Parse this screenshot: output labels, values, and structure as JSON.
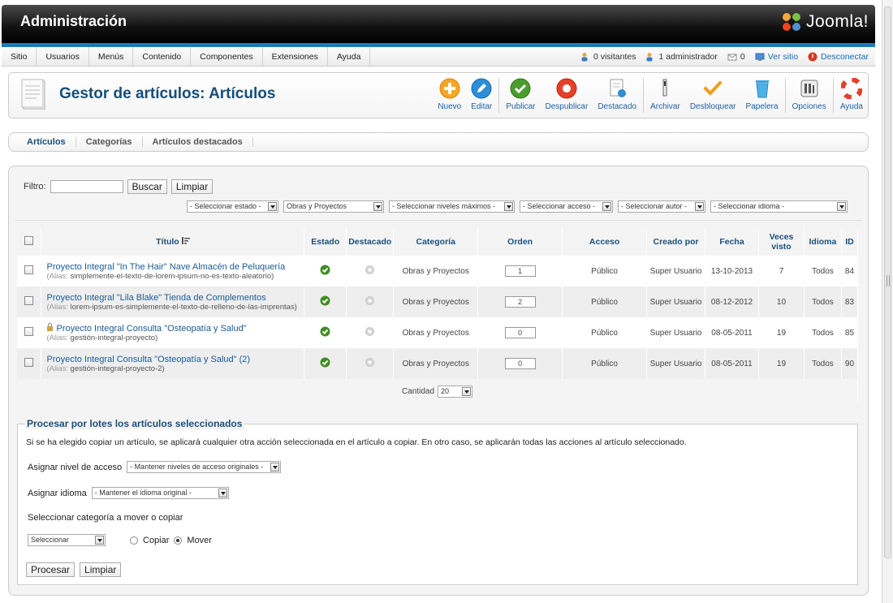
{
  "header": {
    "title": "Administración",
    "logo_text": "Joomla!"
  },
  "menu": {
    "items": [
      "Sitio",
      "Usuarios",
      "Menús",
      "Contenido",
      "Componentes",
      "Extensiones",
      "Ayuda"
    ]
  },
  "status": {
    "visitors": "0 visitantes",
    "admins": "1 administrador",
    "messages": "0",
    "view_site": "Ver sitio",
    "logout": "Desconectar"
  },
  "toolbar": {
    "page_title": "Gestor de artículos: Artículos",
    "buttons": {
      "new": "Nuevo",
      "edit": "Editar",
      "publish": "Publicar",
      "unpublish": "Despublicar",
      "featured": "Destacado",
      "archive": "Archivar",
      "checkin": "Desbloquear",
      "trash": "Papelera",
      "options": "Opciones",
      "help": "Ayuda"
    }
  },
  "subtabs": {
    "articles": "Artículos",
    "categories": "Categorías",
    "featured": "Artículos destacados"
  },
  "filter": {
    "label": "Filtro:",
    "search_btn": "Buscar",
    "clear_btn": "Limpiar",
    "selects": {
      "state": "- Seleccionar estado -",
      "category": "Obras y Proyectos",
      "levels": "- Seleccionar niveles máximos -",
      "access": "- Seleccionar acceso -",
      "author": "- Seleccionar autor -",
      "language": "- Seleccionar idioma -"
    }
  },
  "table": {
    "headers": {
      "title": "Título",
      "state": "Estado",
      "featured": "Destacado",
      "category": "Categoría",
      "order": "Orden",
      "access": "Acceso",
      "created_by": "Creado por",
      "date": "Fecha",
      "hits": "Veces visto",
      "language": "Idioma",
      "id": "ID"
    },
    "alias_label": "(Alias:",
    "rows": [
      {
        "title": "Proyecto Integral \"In The Hair\" Nave Almacén de Peluquería",
        "alias": "simplemente-el-texto-de-lorem-ipsum-no-es-texto-aleatorio)",
        "category": "Obras y Proyectos",
        "order": "1",
        "access": "Público",
        "author": "Super Usuario",
        "date": "13-10-2013",
        "hits": "7",
        "language": "Todos",
        "id": "84"
      },
      {
        "title": "Proyecto Integral \"Lila Blake\" Tienda de Complementos",
        "alias": "lorem-ipsum-es-simplemente-el-texto-de-relleno-de-las-imprentas)",
        "category": "Obras y Proyectos",
        "order": "2",
        "access": "Público",
        "author": "Super Usuario",
        "date": "08-12-2012",
        "hits": "10",
        "language": "Todos",
        "id": "83"
      },
      {
        "title": "Proyecto Integral Consulta \"Osteopatía y Salud\"",
        "alias": "gestión-integral-proyecto)",
        "category": "Obras y Proyectos",
        "order": "0",
        "access": "Público",
        "author": "Super Usuario",
        "date": "08-05-2011",
        "hits": "19",
        "language": "Todos",
        "id": "85"
      },
      {
        "title": "Proyecto Integral Consulta \"Osteopatía y Salud\" (2)",
        "alias": "gestión-integral-proyecto-2)",
        "category": "Obras y Proyectos",
        "order": "0",
        "access": "Público",
        "author": "Super Usuario",
        "date": "08-05-2011",
        "hits": "19",
        "language": "Todos",
        "id": "90"
      }
    ],
    "footer": {
      "limit_label": "Cantidad",
      "limit_value": "20"
    }
  },
  "batch": {
    "legend": "Procesar por lotes los artículos seleccionados",
    "description": "Si se ha elegido copiar un artículo, se aplicará cualquier otra acción seleccionada en el artículo a copiar. En otro caso, se aplicarán todas las acciones al artículo seleccionado.",
    "access_label": "Asignar nivel de acceso",
    "access_value": "- Mantener niveles de acceso originales -",
    "language_label": "Asignar idioma",
    "language_value": "- Mantener el idioma original -",
    "category_label": "Seleccionar categoría a mover o copiar",
    "category_value": "Seleccionar",
    "copy_label": "Copiar",
    "move_label": "Mover",
    "process_btn": "Procesar",
    "clear_btn": "Limpiar"
  }
}
